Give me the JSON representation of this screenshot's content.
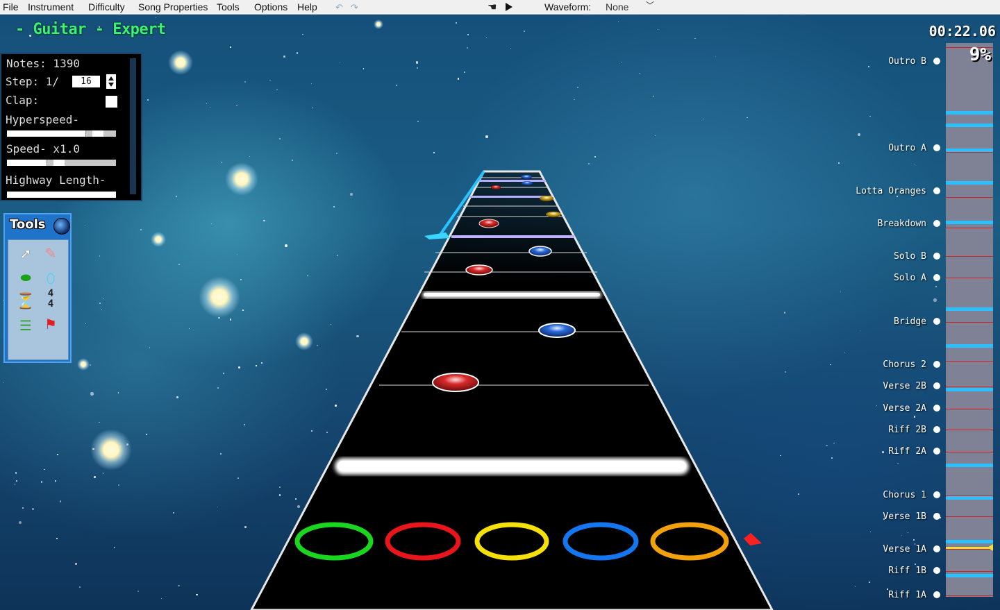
{
  "menu": {
    "items": [
      "File",
      "Instrument",
      "Difficulty",
      "Song Properties",
      "Tools",
      "Options",
      "Help"
    ],
    "waveform_label": "Waveform:",
    "waveform_value": "None"
  },
  "chart_title": "- Guitar - Expert",
  "timer": "00:22.06",
  "info_panel": {
    "notes": "Notes: 1390",
    "step_label": "Step: 1/",
    "step_value": "16",
    "clap_label": "Clap:",
    "hyperspeed_label": "Hyperspeed-",
    "hyperspeed_level": 0.72,
    "speed_label": "Speed- x1.0",
    "speed_level": 0.36,
    "highway_length_label": "Highway Length-"
  },
  "tools_panel": {
    "title": "Tools",
    "tools": [
      "cursor-icon",
      "eraser-icon",
      "note-icon",
      "starpower-icon",
      "metronome-icon",
      "time-signature-icon",
      "section-icon",
      "event-flag-icon"
    ],
    "time_signature": "4/4"
  },
  "frets": {
    "colors": [
      "#19d61f",
      "#e8151b",
      "#f5e109",
      "#1577f0",
      "#f2a00c"
    ]
  },
  "sections": [
    "Outro B",
    "Outro A",
    "Lotta Oranges",
    "Breakdown",
    "Solo B",
    "Solo A",
    "Bridge",
    "Chorus 2",
    "Verse 2B",
    "Verse 2A",
    "Riff 2B",
    "Riff 2A",
    "Chorus 1",
    "Verse 1B",
    "Verse 1A",
    "Riff 1B",
    "Riff 1A"
  ],
  "progress": {
    "percent_text": "9%",
    "fraction": 0.09,
    "marker_color": "#d82020",
    "section_color": "#2bc0ff"
  }
}
